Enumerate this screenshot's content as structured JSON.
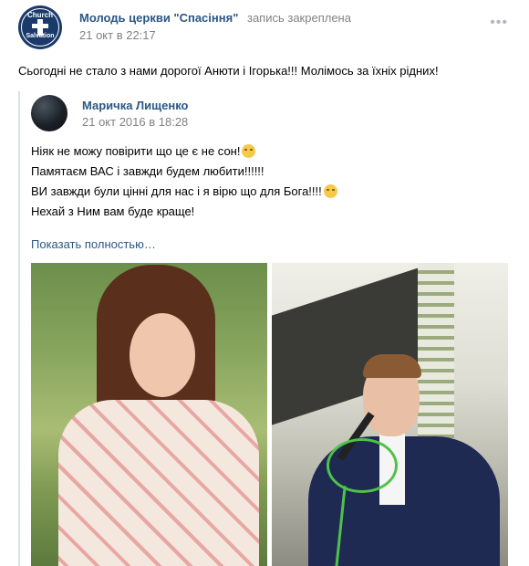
{
  "group": {
    "name": "Молодь церкви \"Спасіння\"",
    "pinned_label": "запись закреплена",
    "date": "21 окт в 22:17",
    "avatar_line1": "Church",
    "avatar_line2": "Salvation",
    "more_icon": "more-dots-icon"
  },
  "post": {
    "text": "Сьогодні не стало з нами дорогої Анюти і Ігорька!!! Молімось за їхніх рідних!"
  },
  "repost": {
    "author": "Маричка Лищенко",
    "date": "21 окт 2016 в 18:28",
    "lines": [
      "Ніяк не можу повірити що це є не сон!",
      "Памятаєм ВАС і завжди будем любити!!!!!!",
      "ВИ завжди були цінні для нас і я вірю що для Бога!!!!",
      "Нехай з Ним вам буде краще!"
    ],
    "show_more": "Показать полностью…"
  },
  "accent_colors": {
    "link": "#2a5885",
    "meta": "#828282"
  }
}
